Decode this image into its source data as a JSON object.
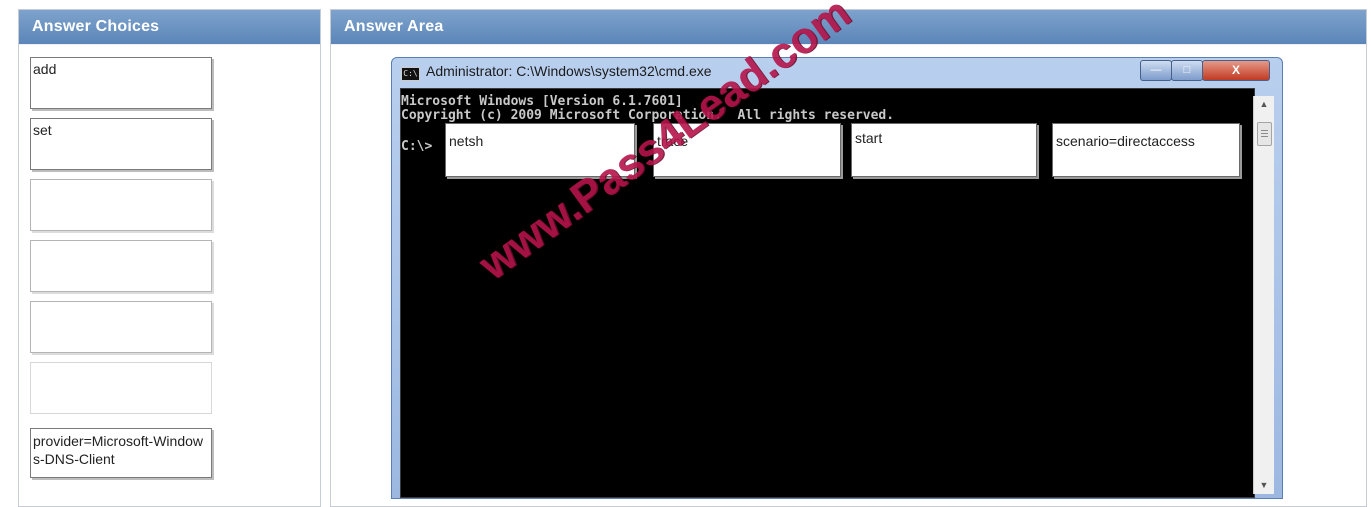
{
  "left_panel": {
    "title": "Answer Choices",
    "choices": [
      "add",
      "set",
      "",
      "",
      "",
      "",
      "provider=Microsoft-Windows-DNS-Client"
    ]
  },
  "right_panel": {
    "title": "Answer Area",
    "window": {
      "title": "Administrator: C:\\Windows\\system32\\cmd.exe",
      "close_glyph": "X",
      "lines": [
        "Microsoft Windows [Version 6.1.7601]",
        "Copyright (c) 2009 Microsoft Corporation.  All rights reserved."
      ],
      "prompt": "C:\\>",
      "answer_slots": [
        "netsh",
        "trace",
        "start",
        "scenario=directaccess"
      ]
    }
  },
  "watermark": "www.Pass4Lead.com",
  "colors": {
    "header_blue": "#6a93c3",
    "console_bg": "#000000",
    "console_text": "#c8c8c8",
    "watermark": "#b5154a"
  }
}
